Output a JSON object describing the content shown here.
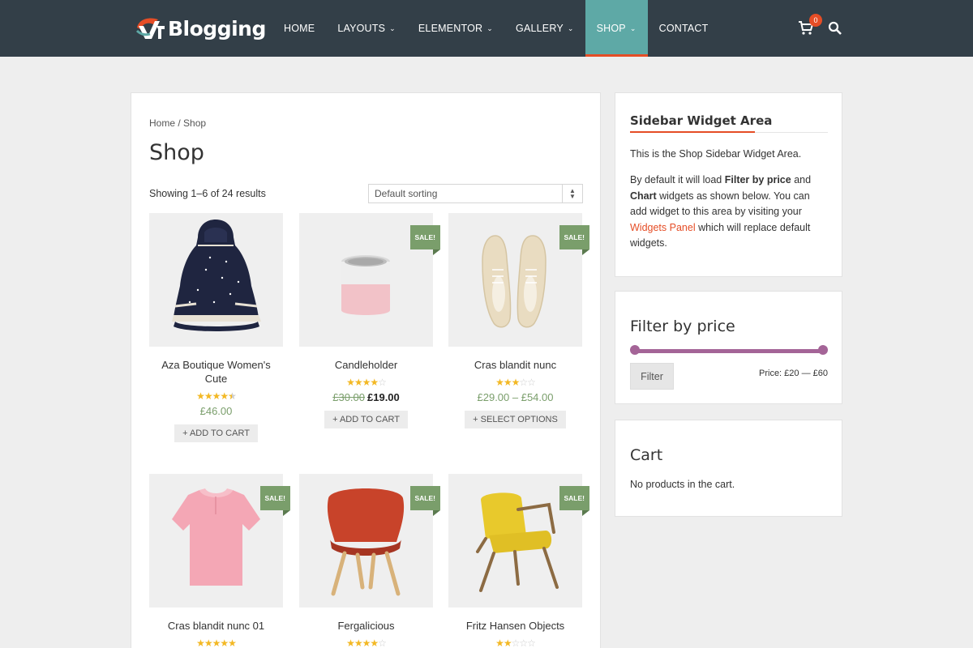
{
  "brand": {
    "logo_text": "Blogging"
  },
  "nav": {
    "items": [
      {
        "label": "HOME",
        "has_dropdown": false
      },
      {
        "label": "LAYOUTS",
        "has_dropdown": true
      },
      {
        "label": "ELEMENTOR",
        "has_dropdown": true
      },
      {
        "label": "GALLERY",
        "has_dropdown": true
      },
      {
        "label": "SHOP",
        "has_dropdown": true,
        "active": true
      },
      {
        "label": "CONTACT",
        "has_dropdown": false
      }
    ],
    "cart_count": "0",
    "cart_icon": "cart-icon",
    "search_icon": "search-icon"
  },
  "shop": {
    "breadcrumb": "Home / Shop",
    "title": "Shop",
    "result_count": "Showing 1–6 of 24 results",
    "sorting": "Default sorting",
    "products": [
      {
        "name": "Aza Boutique Women's Cute",
        "rating": 4.5,
        "price": "£46.00",
        "old_price": "",
        "sale": false,
        "button": "+ ADD TO CART",
        "image": "dress"
      },
      {
        "name": "Candleholder",
        "rating": 4,
        "price": "£19.00",
        "old_price": "£30.00",
        "sale": true,
        "button": "+ ADD TO CART",
        "image": "candleholder"
      },
      {
        "name": "Cras blandit nunc",
        "rating": 3,
        "price": "£29.00 – £54.00",
        "old_price": "",
        "sale": true,
        "button": "+ SELECT OPTIONS",
        "image": "shoes"
      },
      {
        "name": "Cras blandit nunc 01",
        "rating": 5,
        "sale": true,
        "image": "pink-shirt"
      },
      {
        "name": "Fergalicious",
        "rating": 4,
        "sale": true,
        "image": "red-chair"
      },
      {
        "name": "Fritz Hansen Objects",
        "rating": 2,
        "sale": true,
        "image": "yellow-chair"
      }
    ],
    "sale_label": "SALE!"
  },
  "sidebar": {
    "widget_area": {
      "title": "Sidebar Widget Area",
      "intro": "This is the Shop Sidebar Widget Area.",
      "p1": "By default it will load ",
      "b1": "Filter by price",
      "p2": " and ",
      "b2": "Chart",
      "p3": " widgets as shown below. You can add widget to this area by visiting your ",
      "link": "Widgets Panel",
      "p4": " which will replace default widgets."
    },
    "filter": {
      "title": "Filter by price",
      "button": "Filter",
      "price_label": "Price: £20 — £60"
    },
    "cart": {
      "title": "Cart",
      "empty_text": "No products in the cart."
    }
  },
  "colors": {
    "header_bg": "#333f48",
    "accent": "#e54d26",
    "active_nav": "#5ea9a6",
    "sale": "#7a9e6b",
    "slider": "#a46497"
  }
}
